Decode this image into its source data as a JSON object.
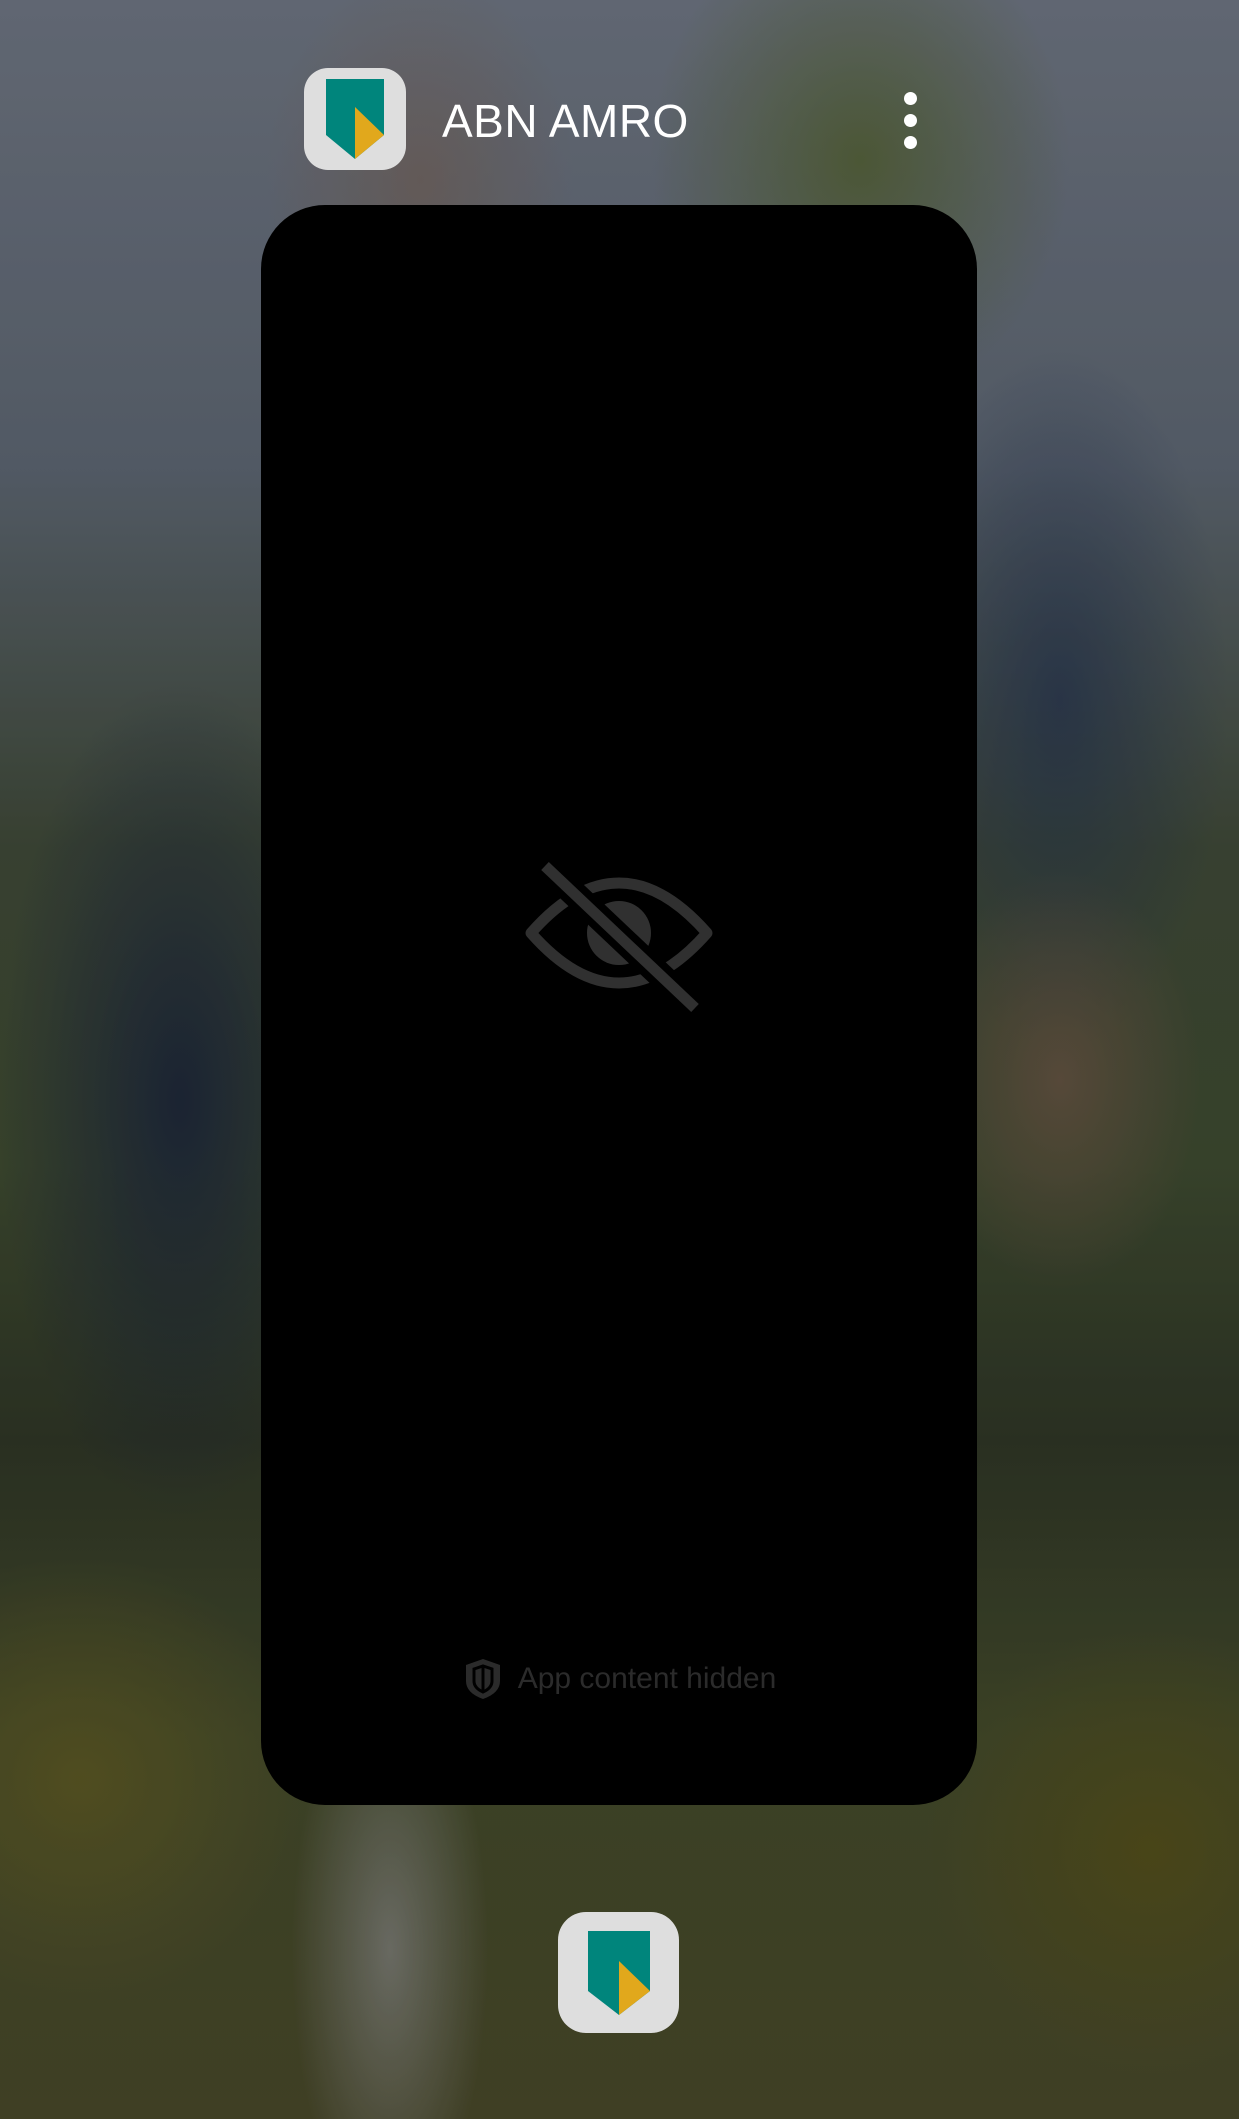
{
  "app": {
    "name": "ABN AMRO",
    "icon": "abn-amro-shield-icon",
    "colors": {
      "shield_green": "#00857c",
      "shield_yellow": "#e1a81c",
      "icon_background": "#dedede"
    }
  },
  "header": {
    "more_options_icon": "three-dots-vertical-icon"
  },
  "preview": {
    "hidden_icon": "eye-off-icon",
    "hidden_label": "App content hidden",
    "hidden_label_icon": "shield-lock-icon"
  },
  "dock": {
    "app_icon": "abn-amro-shield-icon"
  }
}
